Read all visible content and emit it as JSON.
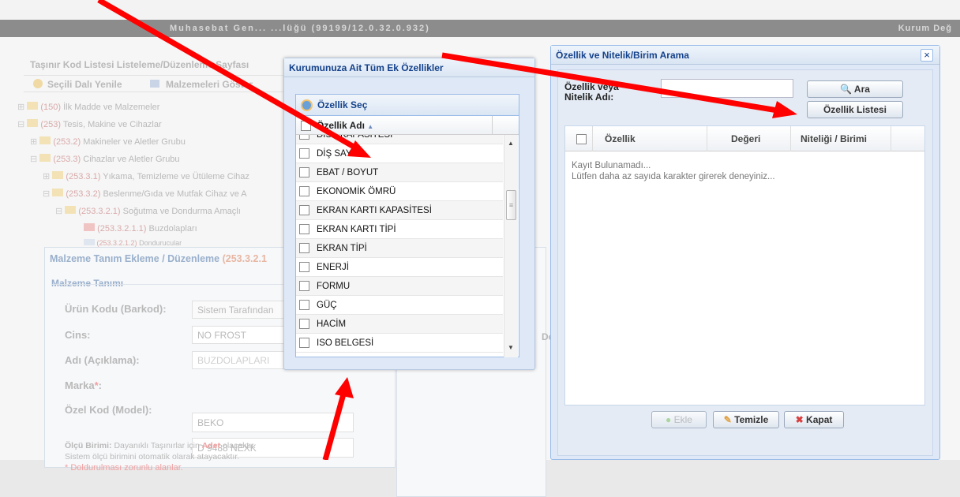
{
  "app_bar": {
    "title": "Muhasebat Gen... ...lüğü (99199/12.0.32.0.932)",
    "right": "Kurum Değ"
  },
  "bg": {
    "page_title": "Taşınır Kod Listesi Listeleme/Düzenleme Sayfası",
    "refresh_label": "Seçili Dalı Yenile",
    "show_materials_label": "Malzemeleri Göster",
    "tree": [
      {
        "code": "(150)",
        "label": "İlk Madde ve Malzemeler"
      },
      {
        "code": "(253)",
        "label": "Tesis, Makine ve Cihazlar"
      },
      {
        "code": "(253.2)",
        "label": "Makineler ve Aletler Grubu"
      },
      {
        "code": "(253.3)",
        "label": "Cihazlar ve Aletler Grubu"
      },
      {
        "code": "(253.3.1)",
        "label": "Yıkama, Temizleme ve Ütüleme Cihaz"
      },
      {
        "code": "(253.3.2)",
        "label": "Beslenme/Gıda ve Mutfak Cihaz ve A"
      },
      {
        "code": "(253.3.2.1)",
        "label": "Soğutma ve Dondurma Amaçlı"
      },
      {
        "code": "(253.3.2.1.1)",
        "label": "Buzdolapları"
      },
      {
        "code": "(253.3.2.1.2)",
        "label": "Dondurucular"
      }
    ],
    "form_title": "Malzeme Tanım Ekleme / Düzenleme",
    "form_title_code": "(253.3.2.1",
    "section": "Malzeme Tanımı",
    "fields": [
      {
        "label": "Ürün Kodu (Barkod):",
        "value": "Sistem Tarafından"
      },
      {
        "label": "Cins:",
        "value": "NO FROST"
      },
      {
        "label": "Adı (Açıklama):",
        "value": "BUZDOLAPLARI"
      },
      {
        "label": "Marka",
        "value": "BEKO"
      },
      {
        "label": "Özel Kod (Model):",
        "value": "D 9488 NEXK"
      }
    ],
    "required_star": "*",
    "colon": ":",
    "olcu_prefix": "Ölçü Birimi:",
    "olcu_text": "Dayanıklı Taşınırlar için",
    "olcu_adet": "Adet",
    "olcu_suffix": "olacaktır.",
    "olcu_line2": "Sistem ölçü birimini otomatik olarak atayacaktır.",
    "required_note": "* Doldurulması zorunlu alanlar.",
    "side_text": "De"
  },
  "ek_window": {
    "title": "Kurumunuza Ait Tüm Ek Özellikler",
    "panel_title": "Özellik Seç",
    "column": "Özellik Adı",
    "sort_icon": "▲",
    "items": [
      "DISK KAPASITESI",
      "DİŞ SAYISI",
      "EBAT / BOYUT",
      "EKONOMİK ÖMRÜ",
      "EKRAN KARTI KAPASİTESİ",
      "EKRAN KARTI TİPİ",
      "EKRAN TİPİ",
      "ENERJİ",
      "FORMU",
      "GÜÇ",
      "HACİM",
      "ISO BELGESİ"
    ]
  },
  "search_window": {
    "title": "Özellik ve Nitelik/Birim Arama",
    "close": "×",
    "field_label_1": "Özellik veya",
    "field_label_2": "Nitelik Adı:",
    "input_value": "",
    "ara_label": "Ara",
    "list_label": "Özellik Listesi",
    "columns": [
      "Özellik",
      "Değeri",
      "Niteliği / Birimi"
    ],
    "empty_1": "Kayıt Bulunamadı...",
    "empty_2": "Lütfen daha az sayıda karakter girerek deneyiniz...",
    "ekle_label": "Ekle",
    "temizle_label": "Temizle",
    "kapat_label": "Kapat"
  },
  "colors": {
    "annotation": "#ff0000",
    "window_title": "#15428b",
    "tree_code": "#d9a9a9"
  }
}
